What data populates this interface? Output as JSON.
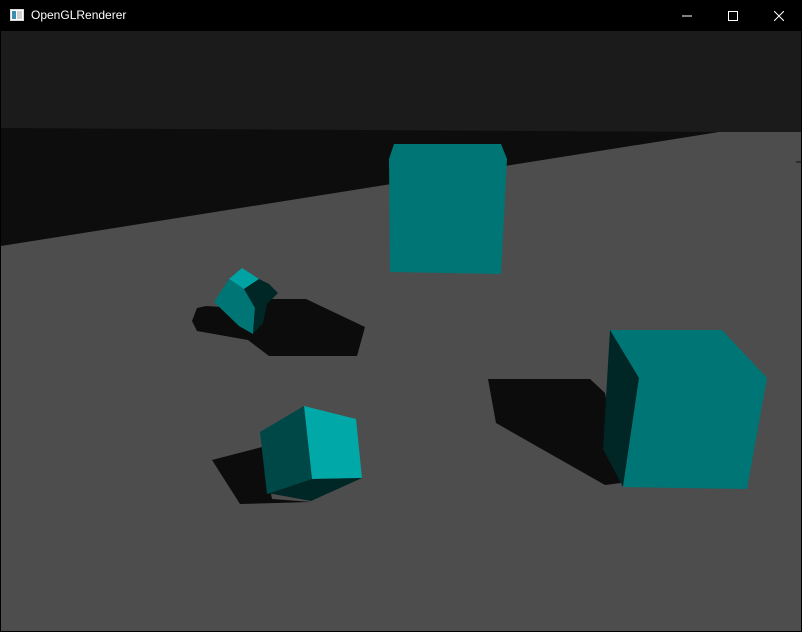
{
  "window": {
    "title": "OpenGLRenderer",
    "icon": "opengl-app-icon",
    "controls": {
      "minimize_icon": "minimize-icon",
      "maximize_icon": "maximize-icon",
      "close_icon": "close-icon"
    }
  },
  "scene": {
    "sky_color": "#1b1b1b",
    "far_band_color": "#0d0d0d",
    "floor_color": "#4d4d4d",
    "shadow_color": "#0c0c0c",
    "cube_colors": {
      "lit": "#007575",
      "bright": "#00a8a8",
      "medium": "#004848",
      "dark": "#002626"
    }
  }
}
